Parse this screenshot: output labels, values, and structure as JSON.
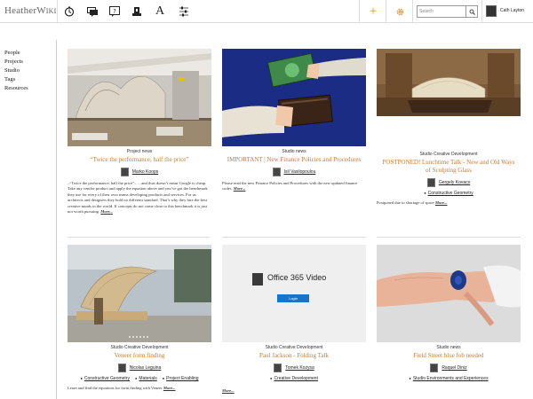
{
  "app": {
    "logo_main": "Heather",
    "logo_suffix": "Wiki"
  },
  "toolbar": {
    "icons": [
      "clock-icon",
      "chat-icon",
      "help-icon",
      "library-icon",
      "font-icon",
      "sliders-icon"
    ],
    "add_icon": "plus-icon",
    "settings_icon": "gear-icon",
    "search_placeholder": "Search",
    "search_icon": "magnifier-icon",
    "user_name": "Cath Layton"
  },
  "sidebar": {
    "items": [
      "People",
      "Projects",
      "Studio",
      "Tags",
      "Resources"
    ]
  },
  "colors": {
    "accent": "#e68a2e",
    "title": "#c77a30"
  },
  "cards": [
    {
      "category": "Project news",
      "title": "“Twice the performance, half the price”",
      "author": "Marko Koops",
      "excerpt": "–“Twice the performance, half the price”– …and thus doesn’t mean Google is cheap. Take any vendor product and apply the equation above and you’ve got the benchmark they use for every of their own teams developing products and services. For us architects and designers they hold no different standard. That’s why they hire the best creative minds in the world. If concepts do not come close to this benchmark it is just not worth pursuing.",
      "more": "More..."
    },
    {
      "category": "Studio news",
      "title": "IMPORTANT | New Finance Policies and Procedures",
      "author": "Isil Vasilopoulou",
      "excerpt": "Please read the new Finance Policies and Procedures with the new updated finance codes.",
      "more": "More..."
    },
    {
      "category": "Studio Creative Development",
      "title": "POSTPONED! Lunchtime Talk - New and Old Ways of Sculpting Glass",
      "author": "Gergely Kovacs",
      "tags": [
        "Constructive Geometry"
      ],
      "excerpt": "Postponed due to shortage of space",
      "more": "More..."
    },
    {
      "category": "Studio Creative Development",
      "title": "Veneer form finding",
      "author": "Nicolas Leguina",
      "tags": [
        "Constructive Geometry",
        "Materials",
        "Project Enabling"
      ],
      "excerpt": "Learn and find the equations for form finding with Veneer",
      "more": "More..."
    },
    {
      "category": "Studio Creative Development",
      "title": "Paul Jackson - Folding Talk",
      "author": "Tomek Kozysa",
      "tags": [
        "Creative Development"
      ],
      "more": "More...",
      "video": {
        "title": "Office 365 Video",
        "button": "Login"
      }
    },
    {
      "category": "Studio news",
      "title": "Field Street blue fob needed",
      "author": "Raquel Diniz",
      "tags": [
        "Studio Environments and Experiences"
      ]
    }
  ]
}
